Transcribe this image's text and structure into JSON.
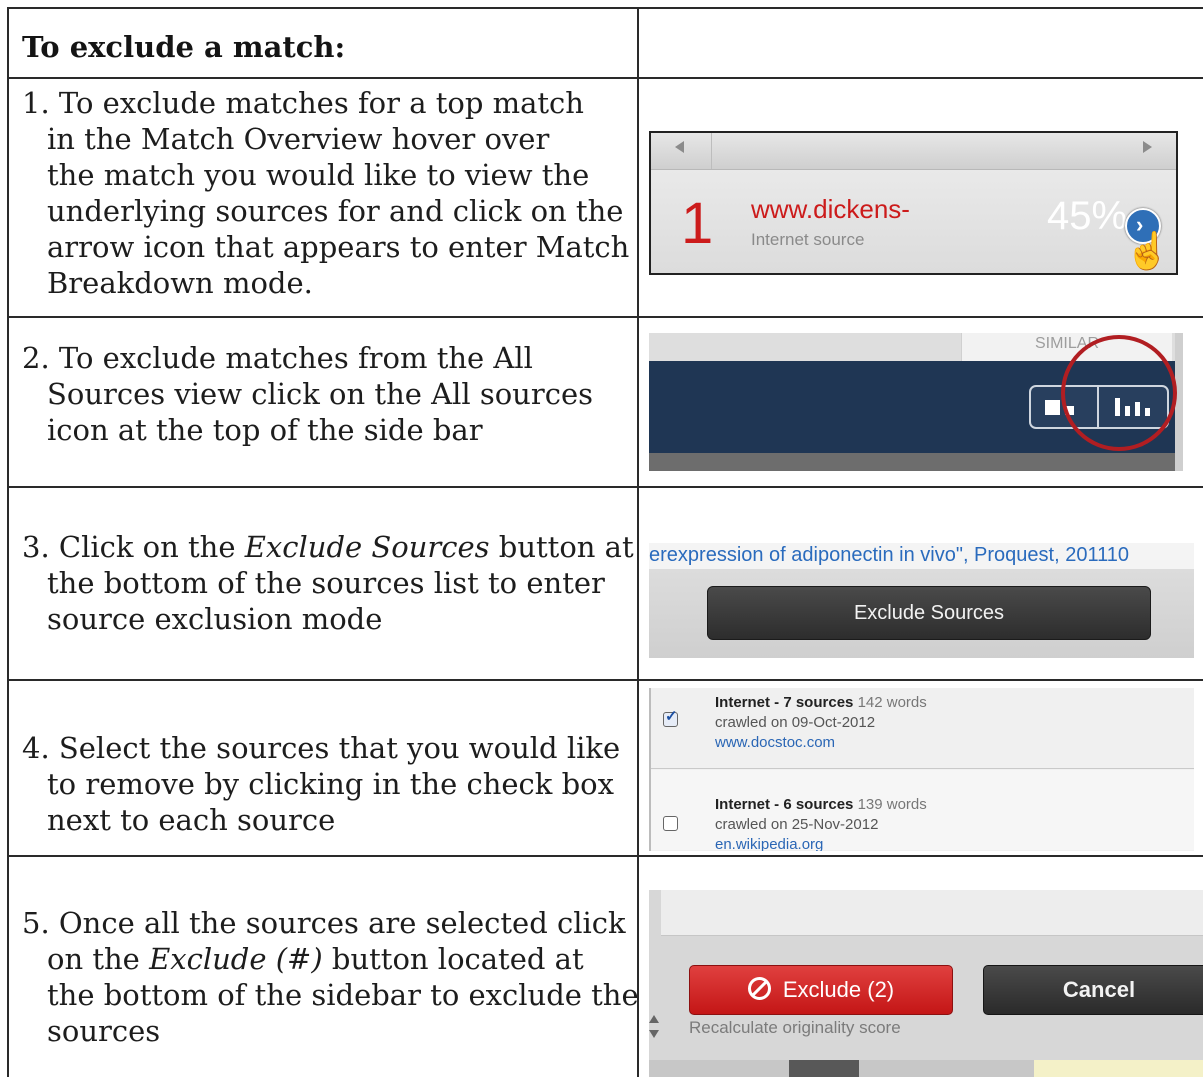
{
  "heading": "To exclude a match:",
  "steps": [
    {
      "number": "1.",
      "lines": [
        "To exclude matches for a top match",
        "in the Match Overview hover over",
        "the match you would like to view the",
        "underlying sources for and click on the",
        "arrow icon that appears to enter Match",
        "Breakdown mode."
      ]
    },
    {
      "number": "2.",
      "lines": [
        "To exclude matches from the All",
        "Sources view click on the All sources",
        "icon at the top of the side bar"
      ]
    },
    {
      "number": "3.",
      "pre": "Click on the ",
      "em": "Exclude Sources",
      "post": " button at",
      "lines": [
        "the bottom of the sources list to enter",
        "source exclusion mode"
      ]
    },
    {
      "number": "4.",
      "lines": [
        "Select the sources that you would like",
        "to remove by clicking in the check box",
        "next to each source"
      ]
    },
    {
      "number": "5.",
      "line1": "Once all the sources are selected click",
      "pre": "on the ",
      "em": "Exclude (#)",
      "post": " button located at",
      "lines": [
        "the bottom of the sidebar to exclude the",
        "sources"
      ]
    }
  ],
  "shot1": {
    "rank": "1",
    "source": "www.dickens-",
    "type": "Internet source",
    "percent": "45%"
  },
  "shot2": {
    "label": "SIMILAR"
  },
  "shot3": {
    "link_text": "erexpression of adiponectin in vivo\", Proquest, 201110",
    "button": "Exclude Sources"
  },
  "shot4": {
    "sources": [
      {
        "title": "Internet - 7 sources",
        "words": "142 words",
        "crawled": "crawled on 09-Oct-2012",
        "url": "www.docstoc.com",
        "checked": true
      },
      {
        "title": "Internet - 6 sources",
        "words": "139 words",
        "crawled": "crawled on 25-Nov-2012",
        "url": "en.wikipedia.org",
        "checked": false
      }
    ]
  },
  "shot5": {
    "exclude_button": "Exclude (2)",
    "cancel_button": "Cancel",
    "recalc": "Recalculate originality score"
  },
  "colors": {
    "turnitin_red": "#cc1b1b",
    "navy_bar": "#1f3654",
    "link_blue": "#2a6bbd",
    "highlight_ring": "#b11e22"
  }
}
